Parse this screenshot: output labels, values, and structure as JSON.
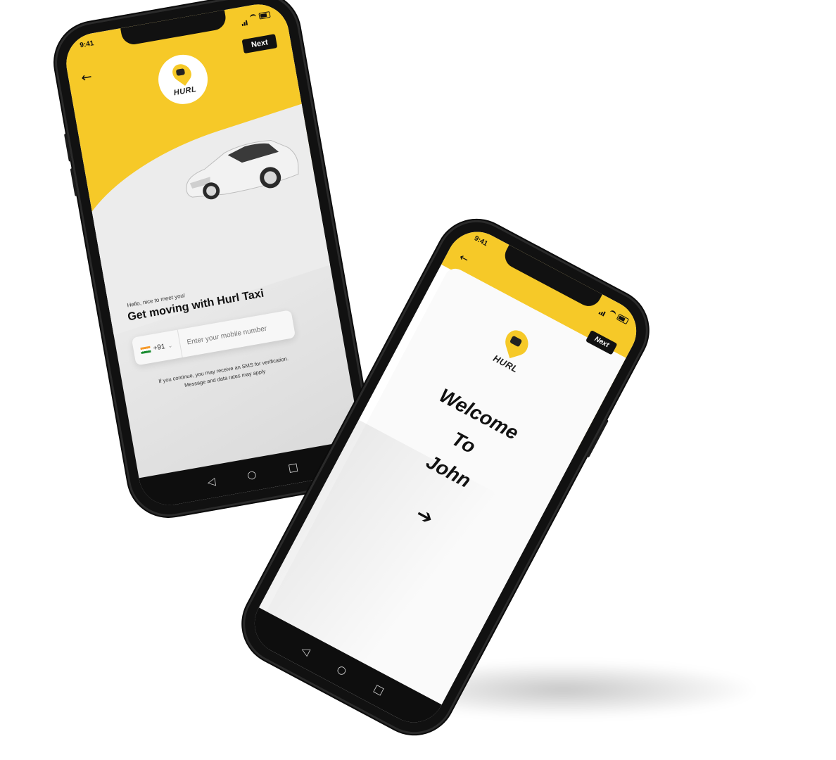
{
  "left_phone": {
    "status_time": "9:41",
    "next_label": "Next",
    "logo_text": "HURL",
    "greeting": "Hello, nice to meet you!",
    "headline": "Get moving with Hurl Taxi",
    "country_code": "+91",
    "mobile_placeholder": "Enter your mobile number",
    "disclaimer": "If you continue, you may receive an SMS for verification. Message and data rates may apply"
  },
  "right_phone": {
    "status_time": "9:41",
    "next_label": "Next",
    "logo_text": "HURL",
    "welcome_line1": "Welcome",
    "welcome_line2": "To",
    "welcome_line3": "John",
    "arrow": "➔"
  },
  "icons": {
    "back": "arrow-left-icon",
    "nav_back": "triangle-back-icon",
    "nav_home": "circle-home-icon",
    "nav_recent": "square-recent-icon"
  },
  "colors": {
    "brand_yellow": "#f6c928",
    "dark": "#111111"
  }
}
